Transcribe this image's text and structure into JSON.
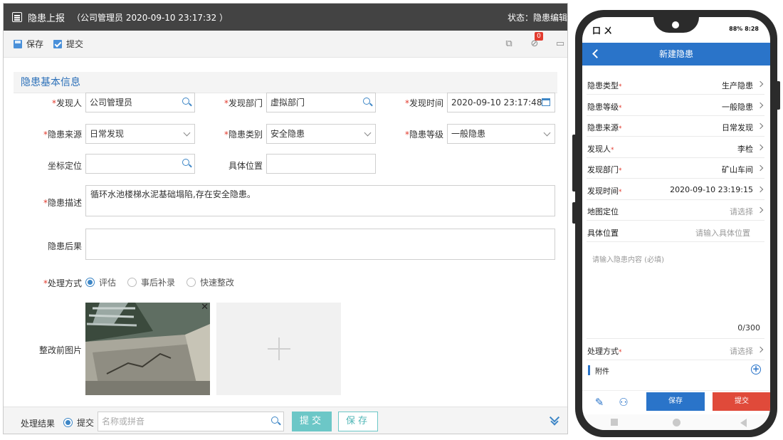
{
  "desktop": {
    "title": "隐患上报",
    "subtitle": "（公司管理员 2020-09-10 23:17:32 ）",
    "status": "状态：隐患编辑",
    "toolbar": {
      "save_label": "保存",
      "submit_label": "提交",
      "attachment_badge": "0"
    },
    "section_title": "隐患基本信息",
    "fields": {
      "finder_label": "发现人",
      "finder_value": "公司管理员",
      "dept_label": "发现部门",
      "dept_value": "虚拟部门",
      "time_label": "发现时间",
      "time_value": "2020-09-10 23:17:48",
      "source_label": "隐患来源",
      "source_value": "日常发现",
      "category_label": "隐患类别",
      "category_value": "安全隐患",
      "level_label": "隐患等级",
      "level_value": "一般隐患",
      "coord_label": "坐标定位",
      "coord_value": "",
      "location_label": "具体位置",
      "location_value": "",
      "desc_label": "隐患描述",
      "desc_value": "循环水池楼梯水泥基础塌陷,存在安全隐患。",
      "consequence_label": "隐患后果",
      "consequence_value": "",
      "handling_label": "处理方式",
      "handling_options": [
        "评估",
        "事后补录",
        "快速整改"
      ],
      "handling_selected": "评估",
      "photos_label": "整改前图片"
    },
    "bottom": {
      "result_label": "处理结果",
      "result_option": "提交",
      "search_placeholder": "名称或拼音",
      "submit_btn": "提交",
      "save_btn": "保存"
    }
  },
  "mobile": {
    "status_left": "口 ㄨ",
    "status_right": "88% 8:28",
    "nav_title": "新建隐患",
    "rows": [
      {
        "label": "隐患类型",
        "required": true,
        "value": "生产隐患",
        "placeholder": false
      },
      {
        "label": "隐患等级",
        "required": true,
        "value": "一般隐患",
        "placeholder": false
      },
      {
        "label": "隐患来源",
        "required": true,
        "value": "日常发现",
        "placeholder": false
      },
      {
        "label": "发现人",
        "required": true,
        "value": "李检",
        "placeholder": false
      },
      {
        "label": "发现部门",
        "required": true,
        "value": "矿山车间",
        "placeholder": false
      },
      {
        "label": "发现时间",
        "required": true,
        "value": "2020-09-10 23:19:15",
        "placeholder": false
      },
      {
        "label": "地图定位",
        "required": false,
        "value": "请选择",
        "placeholder": true
      },
      {
        "label": "具体位置",
        "required": false,
        "value": "请输入具体位置",
        "placeholder": true
      }
    ],
    "content_placeholder": "请输入隐患内容 (必填)",
    "char_count": "0/300",
    "handling_label": "处理方式",
    "handling_placeholder": "请选择",
    "attach_label": "附件",
    "save_btn": "保存",
    "submit_btn": "提交"
  },
  "colors": {
    "accent": "#2a74c9",
    "required": "#e23b2e",
    "teal": "#6cc7c7",
    "danger": "#e04a3a"
  }
}
